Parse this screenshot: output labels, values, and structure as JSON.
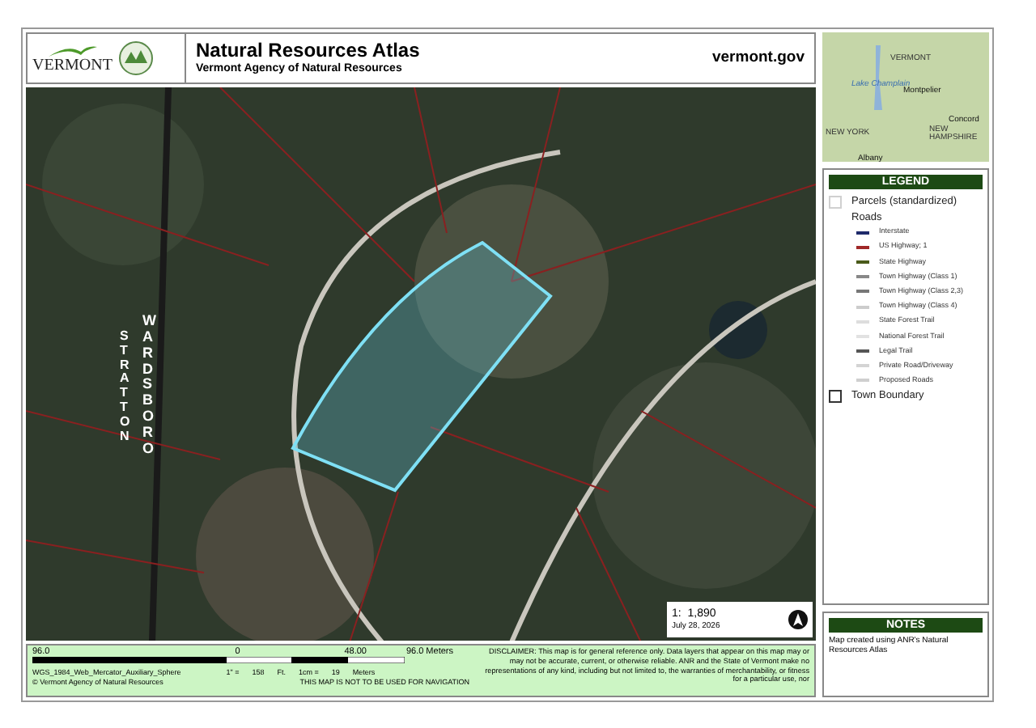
{
  "header": {
    "logo_text": "VERMONT",
    "title": "Natural Resources Atlas",
    "subtitle": "Vermont Agency of Natural Resources",
    "website": "vermont.gov"
  },
  "inset_map": {
    "labels": [
      {
        "text": "VERMONT",
        "kind": "region"
      },
      {
        "text": "Lake Champlain",
        "kind": "water"
      },
      {
        "text": "Montpelier",
        "kind": "city"
      },
      {
        "text": "NEW YORK",
        "kind": "region"
      },
      {
        "text": "Concord",
        "kind": "city"
      },
      {
        "text": "NEW HAMPSHIRE",
        "kind": "region"
      },
      {
        "text": "Albany",
        "kind": "city"
      }
    ]
  },
  "map": {
    "labels": [
      "STRATTON",
      "WARDSBORO"
    ],
    "scale": "1:  1,890",
    "date": "July 28, 2026"
  },
  "legend": {
    "title": "LEGEND",
    "items": [
      {
        "kind": "box",
        "label": "Parcels (standardized)",
        "color": "#d0d0d0"
      },
      {
        "kind": "heading",
        "label": "Roads"
      },
      {
        "kind": "line",
        "label": "Interstate",
        "color": "#1f2a6b"
      },
      {
        "kind": "line",
        "label": "US Highway; 1",
        "color": "#a02828"
      },
      {
        "kind": "line",
        "label": "State Highway",
        "color": "#4a5a1a"
      },
      {
        "kind": "line",
        "label": "Town Highway (Class 1)",
        "color": "#888888"
      },
      {
        "kind": "line",
        "label": "Town Highway (Class 2,3)",
        "color": "#777777"
      },
      {
        "kind": "line",
        "label": "Town Highway (Class 4)",
        "color": "#cccccc"
      },
      {
        "kind": "line",
        "label": "State Forest Trail",
        "color": "#dddddd"
      },
      {
        "kind": "line",
        "label": "National Forest Trail",
        "color": "#e2e2e2"
      },
      {
        "kind": "line",
        "label": "Legal Trail",
        "color": "#555555"
      },
      {
        "kind": "line",
        "label": "Private Road/Driveway",
        "color": "#d4d4d4"
      },
      {
        "kind": "line",
        "label": "Proposed Roads",
        "color": "#cfcfcf"
      },
      {
        "kind": "box",
        "label": "Town Boundary",
        "color": "#333333"
      }
    ]
  },
  "scale_bar": {
    "ticks": [
      "96.0",
      "0",
      "48.00",
      "96.0 Meters"
    ],
    "projection": "WGS_1984_Web_Mercator_Auxiliary_Sphere",
    "inch_label": "1\" =",
    "inch_value": "158",
    "inch_unit": "Ft.",
    "cm_label": "1cm =",
    "cm_value": "19",
    "cm_unit": "Meters",
    "copyright": "© Vermont Agency of Natural Resources",
    "warning": "THIS MAP IS NOT TO BE USED FOR NAVIGATION",
    "disclaimer": "DISCLAIMER: This map is for general reference only. Data layers that appear on this map may or may not be accurate, current, or otherwise reliable. ANR and the State of Vermont make no representations of any kind, including but not limited to, the warranties of merchantability, or fitness for a particular use, nor"
  },
  "notes": {
    "title": "NOTES",
    "text": "Map created using ANR's Natural Resources Atlas"
  }
}
